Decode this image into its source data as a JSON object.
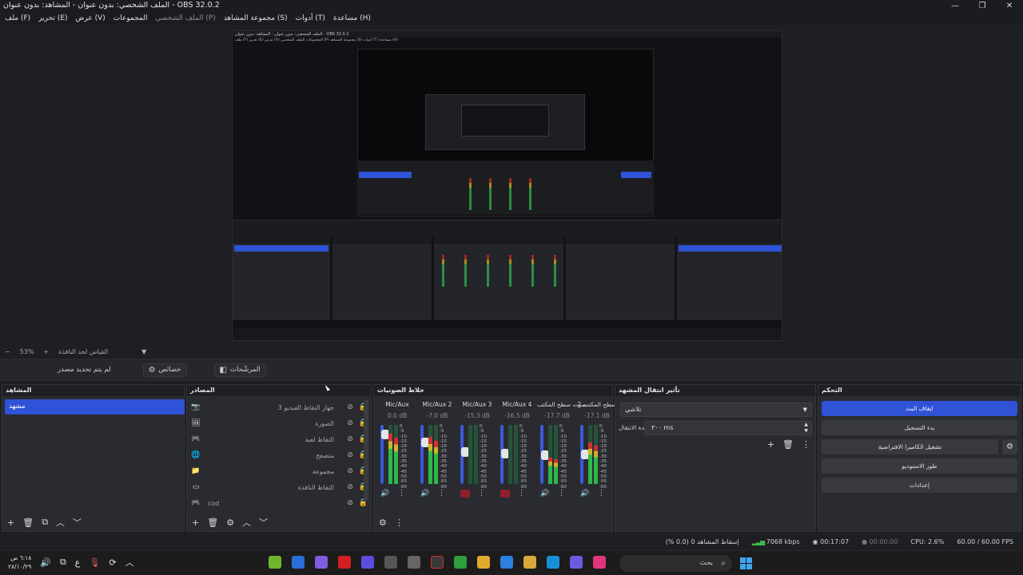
{
  "window": {
    "title": "الملف الشخصي: بدون عنوان - المشاهد: بدون عنوان - OBS 32.0.2",
    "minimize": "—",
    "maximize": "❐",
    "close": "✕"
  },
  "menu": [
    "ملف (F)",
    "تحرير (E)",
    "عرض (V)",
    "المجموعات",
    "الملف الشخصي (P)",
    "مجموعة المشاهد (S)",
    "أدوات (T)",
    "مساعدة (H)"
  ],
  "nested_preview": {
    "title": "الملف الشخصي: بدون عنوان - المشاهد: بدون عنوان - OBS 32.0.2",
    "menu": "ملف (F)   تحرير (E)   عرض (V)   المجموعات   الملف الشخصي (P)   مجموعة المشاهد (S)   أدوات (T)   مساعدة (H)"
  },
  "zoom": {
    "minus": "−",
    "value": "53%",
    "plus": "+",
    "mode": "القياس لحد النافذة",
    "arrow": "▼"
  },
  "context_bar": {
    "no_source": "لم يتم تحديد مصدر",
    "properties": "خصائص",
    "filters": "المرشّحات",
    "properties_icon": "gear-icon",
    "filters_icon": "filter-icon"
  },
  "scenes": {
    "header": "المشاهد",
    "items": [
      "مشهد"
    ],
    "footer": [
      "+",
      "🗑",
      "⧉",
      "︿",
      "﹀"
    ]
  },
  "sources": {
    "header": "المصادر",
    "items": [
      {
        "icon": "📷",
        "name": "جهاز التقاط الفيديو 3"
      },
      {
        "icon": "🖼",
        "name": "الصورة"
      },
      {
        "icon": "🎮",
        "name": "التقاط لعبة"
      },
      {
        "icon": "🌐",
        "name": "متصفح"
      },
      {
        "icon": "📁",
        "name": "مجموعة"
      },
      {
        "icon": "▭",
        "name": "التقاط النافذة"
      },
      {
        "icon": "🎮",
        "name": "cod"
      }
    ],
    "footer": [
      "+",
      "🗑",
      "⚙",
      "︿",
      "﹀"
    ]
  },
  "mixer": {
    "header": "خلاط الصوتيات",
    "channels": [
      {
        "name": "Mic/Aux",
        "db": "0.0 dB",
        "level": 0.85,
        "fader": 0.9,
        "muted": false
      },
      {
        "name": "Mic/Aux 2",
        "db": "-7.0 dB",
        "level": 0.8,
        "fader": 0.75,
        "muted": false
      },
      {
        "name": "Mic/Aux 3",
        "db": "-15.3 dB",
        "level": 0.0,
        "fader": 0.55,
        "muted": true
      },
      {
        "name": "Mic/Aux 4",
        "db": "-16.5 dB",
        "level": 0.0,
        "fader": 0.52,
        "muted": true
      },
      {
        "name": "صوت سطح المكتب",
        "db": "-17.7 dB",
        "level": 0.45,
        "fader": 0.48,
        "muted": false
      },
      {
        "name": "سطح المكتب 2",
        "db": "-17.1 dB",
        "level": 0.7,
        "fader": 0.5,
        "muted": false
      }
    ],
    "scale": [
      "0",
      "-5",
      "-10",
      "-15",
      "-20",
      "-25",
      "-30",
      "-35",
      "-40",
      "-45",
      "-50",
      "-55",
      "-60"
    ],
    "footer": [
      "⚙",
      "⋮"
    ]
  },
  "transitions": {
    "header": "تأثير انتقال المشهد",
    "selected": "تلاشي",
    "duration_label": "مدة الانتقال",
    "duration_value": "٣٠٠ ms",
    "icons": [
      "+",
      "🗑",
      "⋮"
    ]
  },
  "controls": {
    "header": "التحكم",
    "stop_stream": "ايقاف البث",
    "start_recording": "بدء التسجيل",
    "virtual_camera": "تشغيل الكاميرا الافتراضية",
    "studio_mode": "طور الاستوديو",
    "settings": "إعدادات"
  },
  "status": {
    "dropped": "إسقاط المشاهد 0 (0.0 %)",
    "bitrate": "7068 kbps",
    "stream_time": "00:17:07",
    "record_time": "00:00:00",
    "cpu": "CPU: 2.6%",
    "fps": "60.00 / 60.00 FPS"
  },
  "taskbar": {
    "time": "٦:١٨ ص",
    "date": "٢٨/١٠/٢٩",
    "lang": "ع",
    "search_placeholder": "بحث"
  },
  "colors": {
    "accent": "#2f52d6",
    "muted": "#8e1f2b",
    "meter_green": "#2db84c"
  }
}
